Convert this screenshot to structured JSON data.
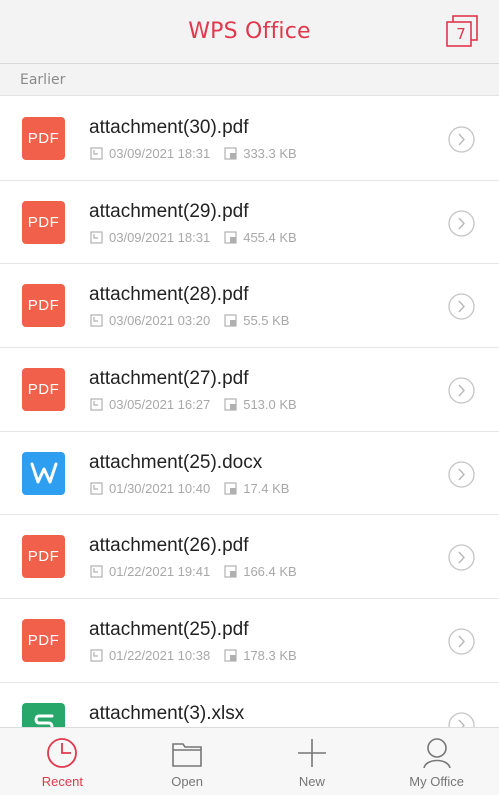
{
  "header": {
    "title": "WPS Office",
    "tab_count": "7"
  },
  "section": {
    "label": "Earlier"
  },
  "files": [
    {
      "name": "attachment(30).pdf",
      "type": "pdf",
      "icon": "PDF",
      "date": "03/09/2021 18:31",
      "size": "333.3 KB"
    },
    {
      "name": "attachment(29).pdf",
      "type": "pdf",
      "icon": "PDF",
      "date": "03/09/2021 18:31",
      "size": "455.4 KB"
    },
    {
      "name": "attachment(28).pdf",
      "type": "pdf",
      "icon": "PDF",
      "date": "03/06/2021 03:20",
      "size": "55.5 KB"
    },
    {
      "name": "attachment(27).pdf",
      "type": "pdf",
      "icon": "PDF",
      "date": "03/05/2021 16:27",
      "size": "513.0 KB"
    },
    {
      "name": "attachment(25).docx",
      "type": "docx",
      "icon": "W",
      "date": "01/30/2021 10:40",
      "size": "17.4 KB"
    },
    {
      "name": "attachment(26).pdf",
      "type": "pdf",
      "icon": "PDF",
      "date": "01/22/2021 19:41",
      "size": "166.4 KB"
    },
    {
      "name": "attachment(25).pdf",
      "type": "pdf",
      "icon": "PDF",
      "date": "01/22/2021 10:38",
      "size": "178.3 KB"
    },
    {
      "name": "attachment(3).xlsx",
      "type": "xlsx",
      "icon": "S",
      "date": "",
      "size": ""
    }
  ],
  "nav": {
    "recent": "Recent",
    "open": "Open",
    "new": "New",
    "my_office": "My Office"
  },
  "colors": {
    "accent": "#e0384d",
    "pdf": "#f0604a",
    "docx": "#2e9ef0",
    "xlsx": "#27a86a"
  }
}
